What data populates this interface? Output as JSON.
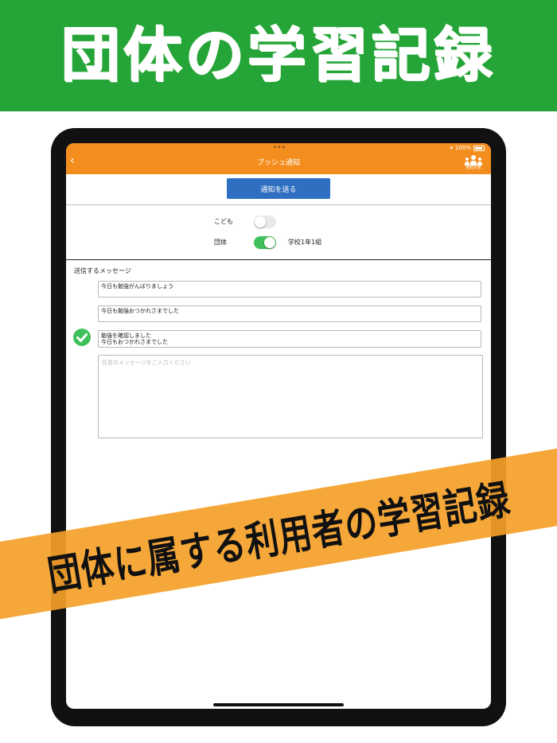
{
  "banner": {
    "title": "団体の学習記録"
  },
  "status_bar": {
    "dots": "•••",
    "battery": "100%"
  },
  "navbar": {
    "title": "プッシュ通知",
    "back_icon": "‹",
    "recipients_label": "通知対象"
  },
  "send_button": {
    "label": "通知を送る"
  },
  "targets": {
    "child": {
      "label": "こども",
      "enabled": false
    },
    "group": {
      "label": "団体",
      "enabled": true,
      "group_name": "学校1年1組"
    }
  },
  "messages": {
    "title": "送信するメッセージ",
    "items": [
      {
        "lines": [
          "今日も勉強がんばりましょう"
        ],
        "selected": false
      },
      {
        "lines": [
          "今日も勉強おつかれさまでした"
        ],
        "selected": false
      },
      {
        "lines": [
          "勉強を確認しました",
          "今日もおつかれさまでした"
        ],
        "selected": true
      }
    ],
    "custom_placeholder": "任意のメッセージをご入力ください"
  },
  "ribbon": {
    "text": "団体に属する利用者の学習記録"
  },
  "colors": {
    "banner_green": "#25a537",
    "navbar_orange": "#f38e1e",
    "button_blue": "#2f6fc1",
    "toggle_on": "#3ec05b",
    "ribbon_orange": "#f4a028"
  }
}
